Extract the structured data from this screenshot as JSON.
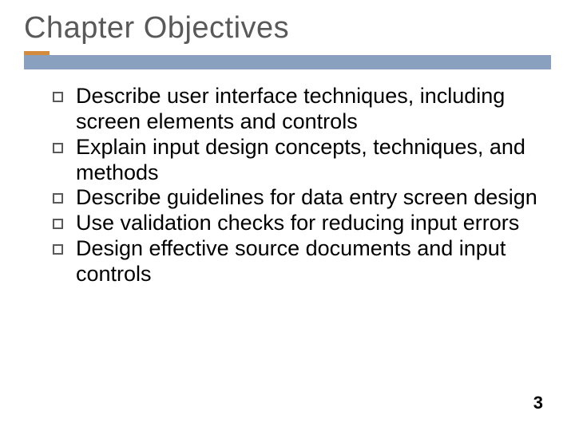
{
  "slide": {
    "title": "Chapter Objectives",
    "objectives": [
      "Describe user interface techniques, including screen elements and controls",
      "Explain input design concepts, techniques, and methods",
      "Describe guidelines for data entry screen design",
      "Use validation checks for reducing input errors",
      "Design effective source documents and input controls"
    ],
    "page_number": "3"
  }
}
